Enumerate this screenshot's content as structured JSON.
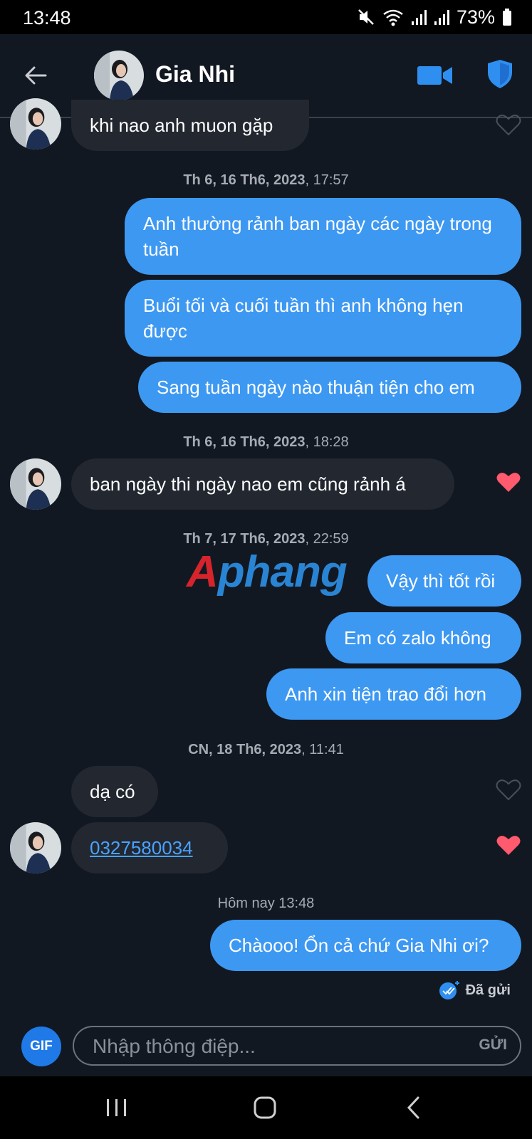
{
  "status_bar": {
    "time": "13:48",
    "battery": "73%"
  },
  "header": {
    "contact_name": "Gia Nhi"
  },
  "messages": [
    {
      "text": "khi nao anh muon gặp"
    },
    {
      "timestamp_date": "Th 6, 16 Th6, 2023",
      "timestamp_time": ", 17:57"
    },
    {
      "text": "Anh thường rảnh ban ngày các ngày trong tuần"
    },
    {
      "text": "Buổi tối và cuối tuần thì anh không hẹn được"
    },
    {
      "text": "Sang tuần ngày nào thuận tiện cho em"
    },
    {
      "timestamp_date": "Th 6, 16 Th6, 2023",
      "timestamp_time": ", 18:28"
    },
    {
      "text": "ban ngày thi ngày nao em cũng rảnh á"
    },
    {
      "timestamp_date": "Th 7, 17 Th6, 2023",
      "timestamp_time": ", 22:59"
    },
    {
      "text": "Vậy thì tốt rồi"
    },
    {
      "text": "Em có zalo không"
    },
    {
      "text": "Anh xin tiện trao đổi hơn"
    },
    {
      "timestamp_date": "CN, 18 Th6, 2023",
      "timestamp_time": ", 11:41"
    },
    {
      "text": "dạ có"
    },
    {
      "text": "0327580034"
    },
    {
      "timestamp_date": "Hôm nay",
      "timestamp_time": " 13:48"
    },
    {
      "text": "Chàooo! Ổn cả chứ Gia Nhi ơi?"
    }
  ],
  "delivery_status": "Đã gửi",
  "watermark": "Aphang",
  "composer": {
    "gif_label": "GIF",
    "placeholder": "Nhập thông điệp...",
    "send_label": "GỬI"
  },
  "colors": {
    "background": "#121821",
    "outgoing_bubble": "#3d98f2",
    "incoming_bubble": "#222730",
    "heart_liked": "#ff5a6e",
    "accent": "#1f7ae8"
  }
}
